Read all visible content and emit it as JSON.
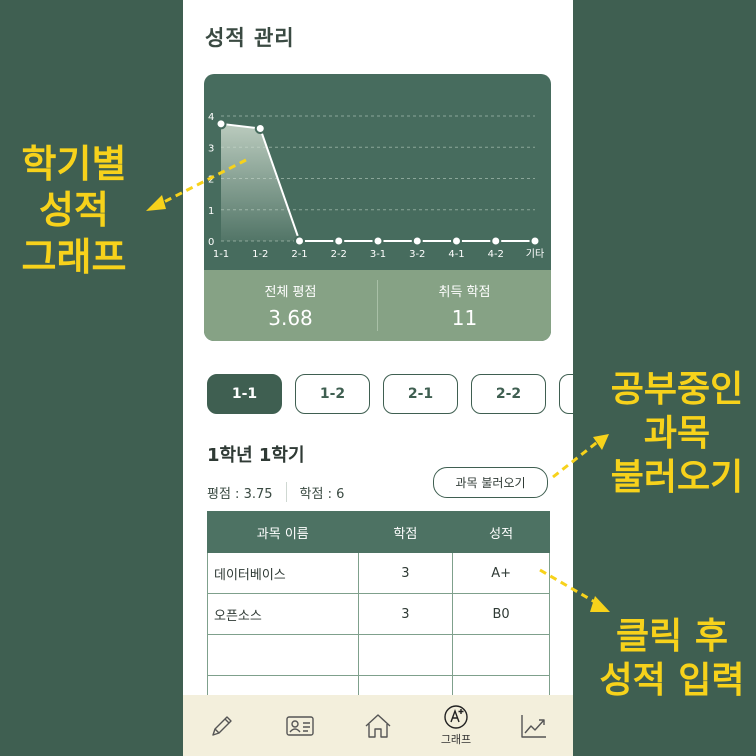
{
  "page": {
    "title": "성적 관리"
  },
  "chart_data": {
    "type": "area",
    "x": [
      "1-1",
      "1-2",
      "2-1",
      "2-2",
      "3-1",
      "3-2",
      "4-1",
      "4-2",
      "기타"
    ],
    "values": [
      3.75,
      3.6,
      0,
      0,
      0,
      0,
      0,
      0,
      0
    ],
    "y_ticks": [
      "0",
      "1",
      "2",
      "3",
      "4"
    ],
    "ylim": [
      0,
      4
    ],
    "grid": true
  },
  "summary": {
    "total_gpa_label": "전체 평점",
    "total_gpa_value": "3.68",
    "credits_label": "취득 학점",
    "credits_value": "11"
  },
  "semester_tabs": [
    "1-1",
    "1-2",
    "2-1",
    "2-2"
  ],
  "semester": {
    "title": "1학년 1학기",
    "gpa_text": "평점 : 3.75",
    "credit_text": "학점 : 6",
    "load_button": "과목 불러오기"
  },
  "table": {
    "headers": [
      "과목 이름",
      "학점",
      "성적"
    ],
    "rows": [
      {
        "name": "데이터베이스",
        "credit": "3",
        "grade": "A+"
      },
      {
        "name": "오픈소스",
        "credit": "3",
        "grade": "B0"
      },
      {
        "name": "",
        "credit": "",
        "grade": ""
      },
      {
        "name": "",
        "credit": "",
        "grade": ""
      }
    ]
  },
  "nav": {
    "items": [
      {
        "icon": "pencil-icon",
        "label": ""
      },
      {
        "icon": "id-card-icon",
        "label": ""
      },
      {
        "icon": "home-icon",
        "label": ""
      },
      {
        "icon": "grade-a-plus-icon",
        "label": "그래프"
      },
      {
        "icon": "trend-chart-icon",
        "label": ""
      }
    ]
  },
  "annotations": {
    "left": "학기별\n성적\n그래프",
    "right_top": "공부중인\n과목\n불러오기",
    "right_bottom": "클릭 후\n성적 입력"
  },
  "colors": {
    "background": "#3f5f51",
    "accent": "#3f5f51",
    "summary": "#86a285",
    "annotation": "#f7d21b",
    "nav": "#f3efdc"
  }
}
